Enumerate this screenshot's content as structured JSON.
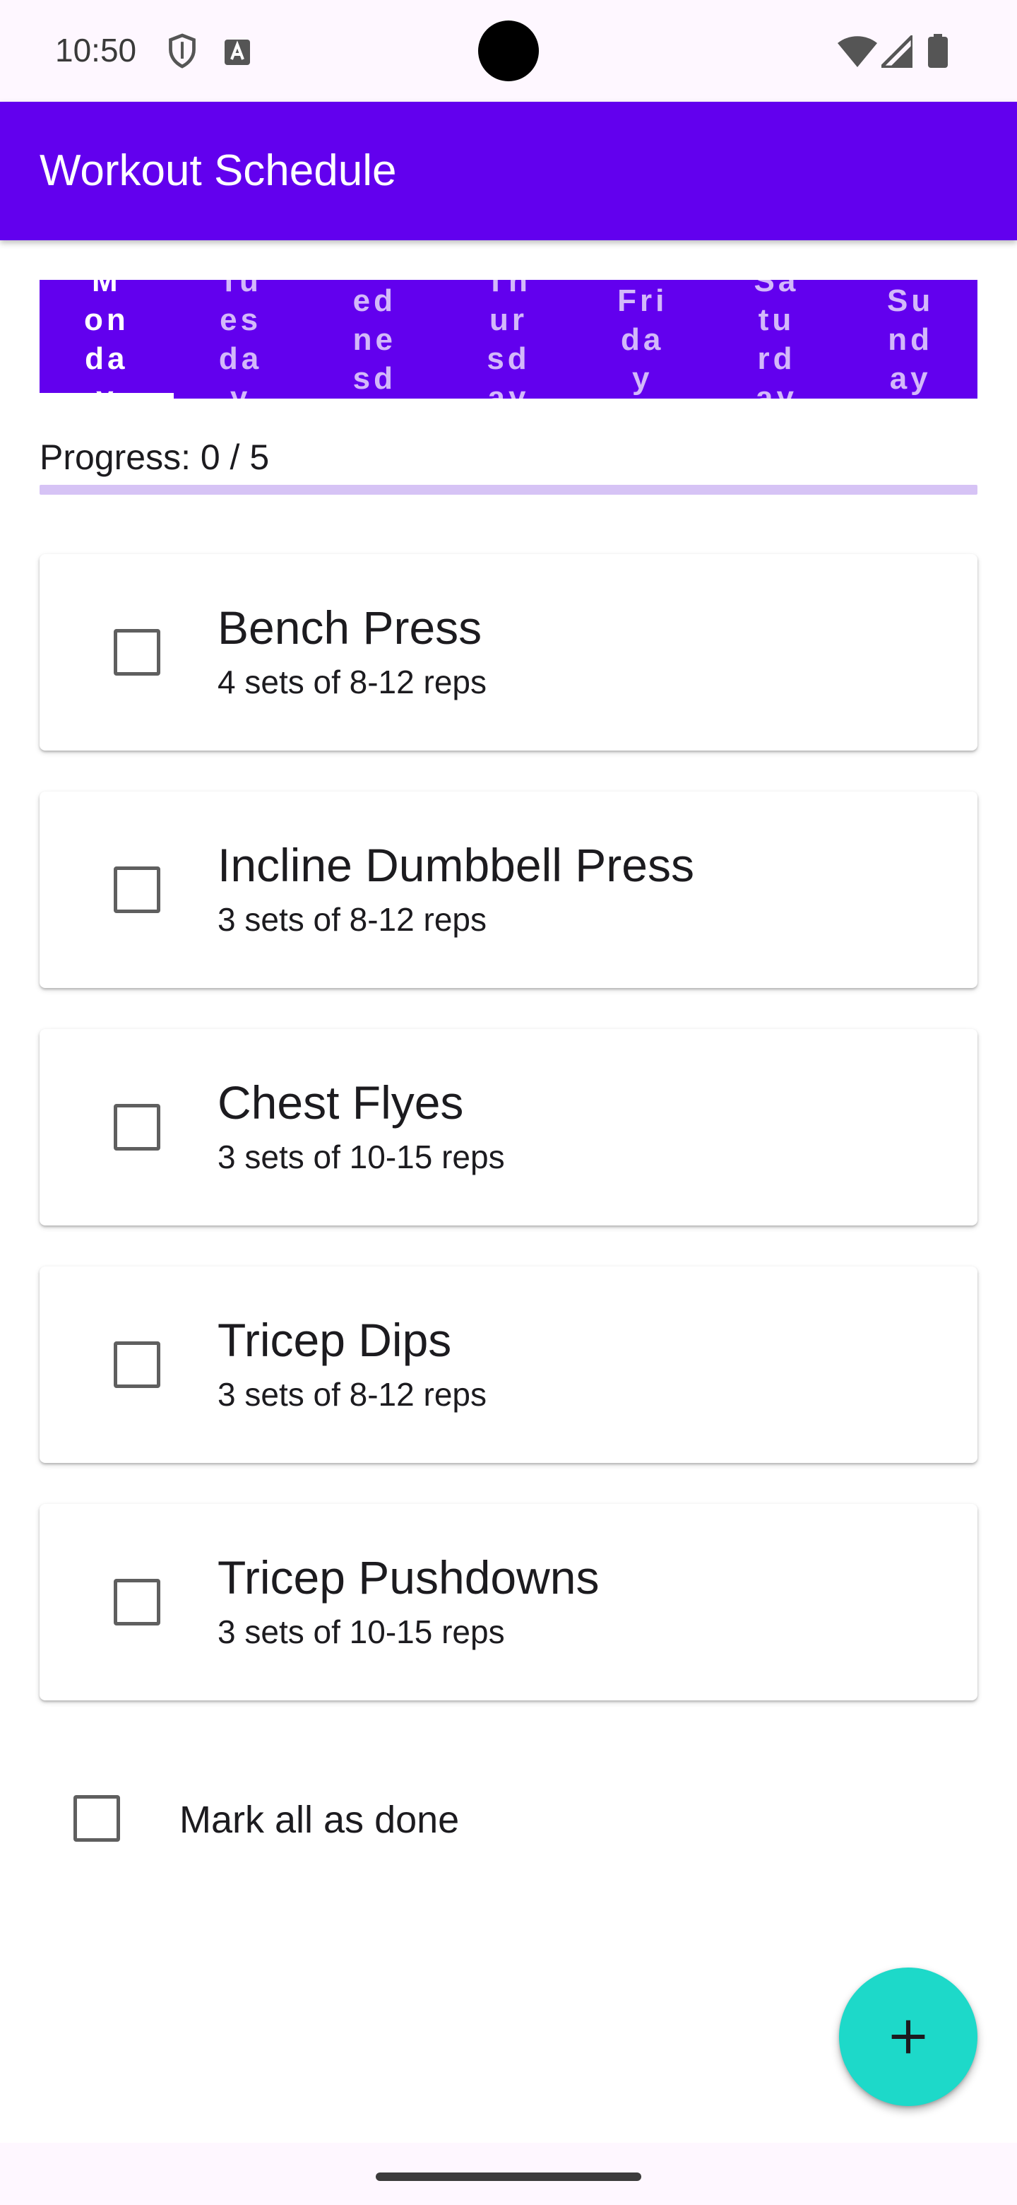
{
  "status_bar": {
    "time": "10:50",
    "left_icons": [
      "shield-icon",
      "font-a-icon"
    ],
    "right_icons": [
      "wifi-icon",
      "signal-icon",
      "battery-icon"
    ]
  },
  "app_bar": {
    "title": "Workout Schedule",
    "color": "#6200EE"
  },
  "tabs": [
    {
      "label": "Monday",
      "active": true
    },
    {
      "label": "Tuesday",
      "active": false
    },
    {
      "label": "Wednesday",
      "active": false
    },
    {
      "label": "Thursday",
      "active": false
    },
    {
      "label": "Friday",
      "active": false
    },
    {
      "label": "Saturday",
      "active": false
    },
    {
      "label": "Sunday",
      "active": false
    }
  ],
  "progress": {
    "label": "Progress: 0 / 5",
    "completed": 0,
    "total": 5,
    "fraction": 0
  },
  "exercises": [
    {
      "name": "Bench Press",
      "detail": "4 sets of 8-12 reps",
      "checked": false
    },
    {
      "name": "Incline Dumbbell Press",
      "detail": "3 sets of 8-12 reps",
      "checked": false
    },
    {
      "name": "Chest Flyes",
      "detail": "3 sets of 10-15 reps",
      "checked": false
    },
    {
      "name": "Tricep Dips",
      "detail": "3 sets of 8-12 reps",
      "checked": false
    },
    {
      "name": "Tricep Pushdowns",
      "detail": "3 sets of 10-15 reps",
      "checked": false
    }
  ],
  "mark_all": {
    "label": "Mark all as done",
    "checked": false
  },
  "fab": {
    "icon": "plus-icon",
    "color": "#1DD9C9"
  }
}
